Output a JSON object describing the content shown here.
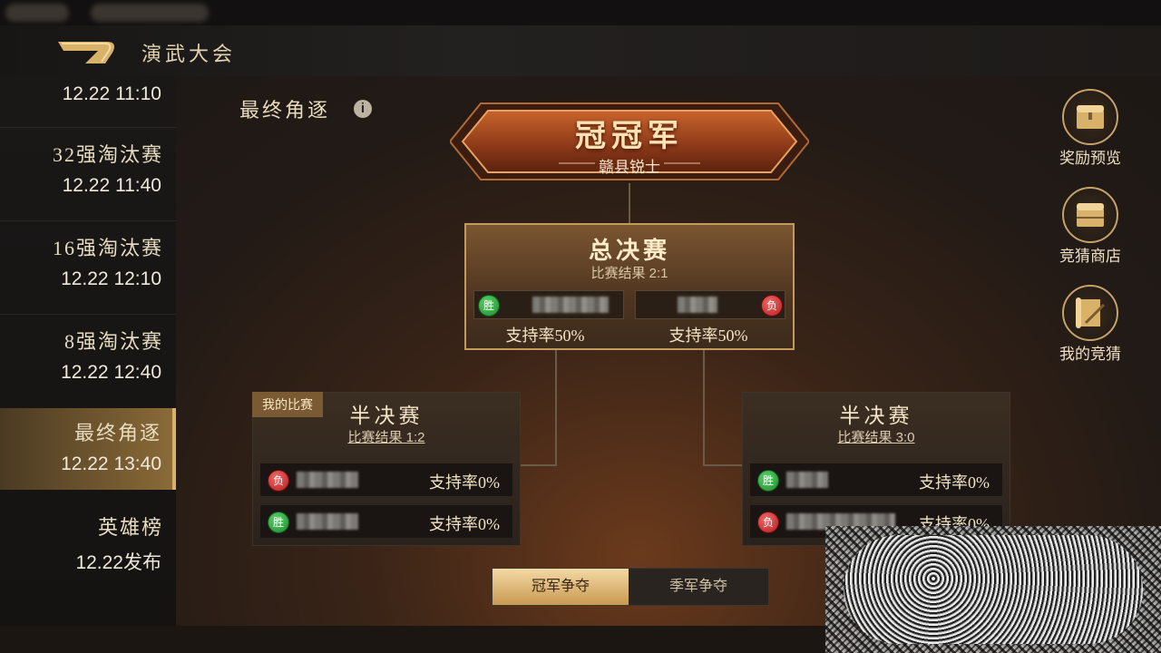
{
  "header": {
    "title": "演武大会"
  },
  "sidebar": {
    "items": [
      {
        "name": "",
        "time": "12.22 11:10"
      },
      {
        "name": "32强淘汰赛",
        "time": "12.22 11:40"
      },
      {
        "name": "16强淘汰赛",
        "time": "12.22 12:10"
      },
      {
        "name": "8强淘汰赛",
        "time": "12.22 12:40"
      },
      {
        "name": "最终角逐",
        "time": "12.22 13:40",
        "active": true
      },
      {
        "name": "英雄榜",
        "time": "12.22发布"
      }
    ]
  },
  "section": {
    "title": "最终角逐",
    "info_icon": "info-icon"
  },
  "champion": {
    "title": "冠冠军",
    "name": "赣县锐士"
  },
  "final": {
    "title": "总决赛",
    "result": "比赛结果 2:1",
    "left": {
      "badge": "胜",
      "support": "支持率50%"
    },
    "right": {
      "badge": "负",
      "support": "支持率50%"
    }
  },
  "semi_left": {
    "tag": "我的比赛",
    "title": "半决赛",
    "result": "比赛结果 1:2",
    "rows": [
      {
        "badge": "负",
        "support": "支持率0%"
      },
      {
        "badge": "胜",
        "support": "支持率0%"
      }
    ]
  },
  "semi_right": {
    "title": "半决赛",
    "result": "比赛结果 3:0",
    "rows": [
      {
        "badge": "胜",
        "support": "支持率0%"
      },
      {
        "badge": "负",
        "support": "支持率0%"
      }
    ]
  },
  "right_buttons": [
    {
      "label": "奖励预览",
      "icon": "chest-icon"
    },
    {
      "label": "竞猜商店",
      "icon": "shop-chest-icon"
    },
    {
      "label": "我的竞猜",
      "icon": "scroll-icon"
    }
  ],
  "tabs": {
    "active": "冠军争夺",
    "inactive": "季军争夺"
  },
  "colors": {
    "win": "#1a8a2c",
    "lose": "#b51c1c",
    "accent": "#c99a52"
  }
}
